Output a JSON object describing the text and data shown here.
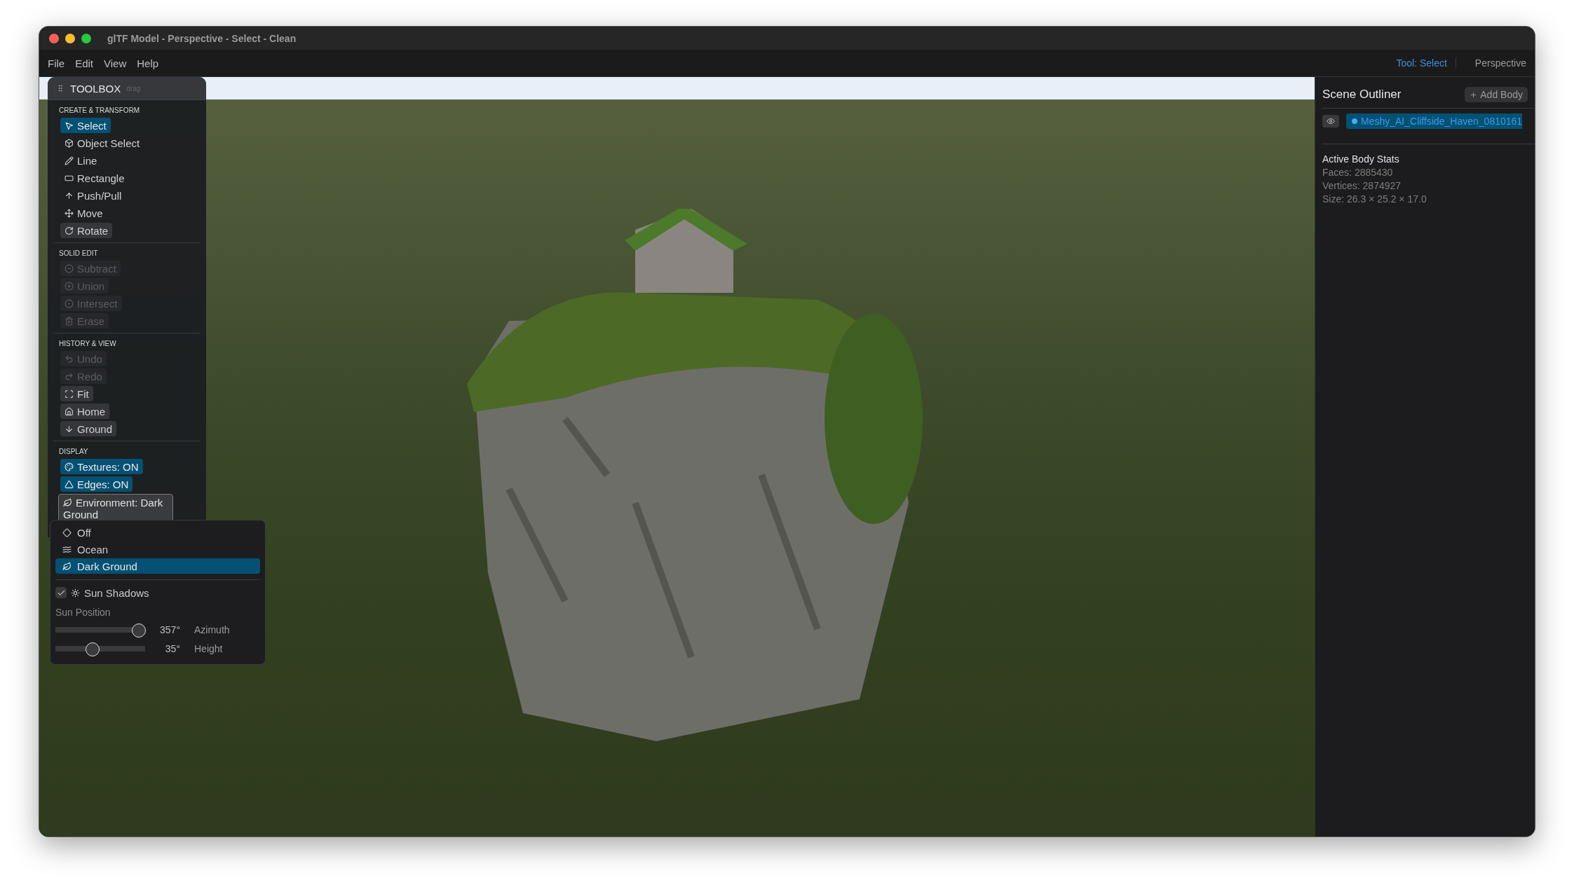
{
  "window": {
    "title": "glTF Model - Perspective - Select - Clean"
  },
  "menu": [
    "File",
    "Edit",
    "View",
    "Help"
  ],
  "status": {
    "tool": "Tool: Select",
    "view": "Perspective"
  },
  "toolbox": {
    "title": "TOOLBOX",
    "hint": "drag",
    "sections": [
      {
        "heading": "CREATE & TRANSFORM",
        "items": [
          {
            "label": "Select",
            "kind": "tool",
            "selected": true,
            "disabled": false
          },
          {
            "label": "Object Select",
            "kind": "tool",
            "selected": false,
            "disabled": false
          },
          {
            "label": "Line",
            "kind": "tool",
            "selected": false,
            "disabled": false
          },
          {
            "label": "Rectangle",
            "kind": "tool",
            "selected": false,
            "disabled": false
          },
          {
            "label": "Push/Pull",
            "kind": "tool",
            "selected": false,
            "disabled": false
          },
          {
            "label": "Move",
            "kind": "tool",
            "selected": false,
            "disabled": false
          },
          {
            "label": "Rotate",
            "kind": "action",
            "selected": false,
            "disabled": false
          }
        ]
      },
      {
        "heading": "SOLID EDIT",
        "items": [
          {
            "label": "Subtract",
            "kind": "action",
            "selected": false,
            "disabled": true
          },
          {
            "label": "Union",
            "kind": "action",
            "selected": false,
            "disabled": true
          },
          {
            "label": "Intersect",
            "kind": "action",
            "selected": false,
            "disabled": true
          },
          {
            "label": "Erase",
            "kind": "action",
            "selected": false,
            "disabled": true
          }
        ]
      },
      {
        "heading": "HISTORY & VIEW",
        "items": [
          {
            "label": "Undo",
            "kind": "action",
            "selected": false,
            "disabled": true
          },
          {
            "label": "Redo",
            "kind": "action",
            "selected": false,
            "disabled": true
          },
          {
            "label": "Fit",
            "kind": "action",
            "selected": false,
            "disabled": false
          },
          {
            "label": "Home",
            "kind": "action",
            "selected": false,
            "disabled": false
          },
          {
            "label": "Ground",
            "kind": "action",
            "selected": false,
            "disabled": false
          }
        ]
      },
      {
        "heading": "DISPLAY",
        "items": [
          {
            "label": "Textures: ON",
            "kind": "toggle",
            "selected": true,
            "disabled": false
          },
          {
            "label": "Edges: ON",
            "kind": "toggle",
            "selected": true,
            "disabled": false
          },
          {
            "label": "Environment: Dark Ground",
            "kind": "dropdown",
            "selected": false,
            "disabled": false
          }
        ]
      }
    ]
  },
  "environment_menu": {
    "options": [
      {
        "label": "Off",
        "selected": false
      },
      {
        "label": "Ocean",
        "selected": false
      },
      {
        "label": "Dark Ground",
        "selected": true
      }
    ],
    "sun_shadows": {
      "label": "Sun Shadows",
      "checked": true
    },
    "sun_position": {
      "label": "Sun Position",
      "sliders": [
        {
          "reading": "357°",
          "label": "Azimuth",
          "level": 0.99
        },
        {
          "reading": "35°",
          "label": "Height",
          "level": 0.39
        }
      ]
    }
  },
  "outliner": {
    "title": "Scene Outliner",
    "add_button": "Add Body",
    "bodies": [
      {
        "name": "Meshy_AI_Cliffside_Haven_0810161",
        "selected": true,
        "visible": true
      }
    ],
    "stats": {
      "title": "Active Body Stats",
      "lines": [
        "Faces: 2885430",
        "Vertices: 2874927",
        "Size: 26.3 × 25.2 × 17.0"
      ]
    }
  }
}
